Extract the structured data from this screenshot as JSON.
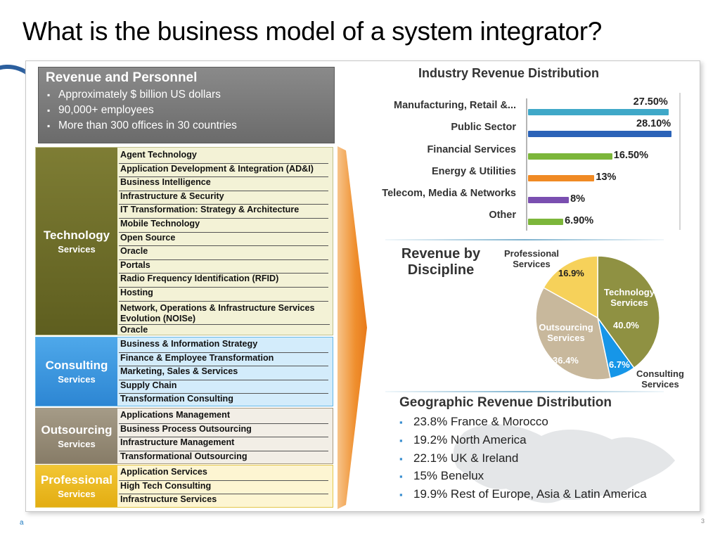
{
  "slide": {
    "title": "What is the business model of a system integrator?",
    "footer_left": "a",
    "footer_right": "3"
  },
  "revenue_personnel": {
    "title": "Revenue and Personnel",
    "items": [
      "Approximately $  billion US dollars",
      "90,000+ employees",
      "More than 300 offices in 30 countries"
    ]
  },
  "services": {
    "technology": {
      "title": "Technology",
      "subtitle": "Services",
      "items": [
        "Agent Technology",
        "Application Development & Integration (AD&I)",
        "Business Intelligence",
        "Infrastructure & Security",
        "IT Transformation: Strategy & Architecture",
        "Mobile Technology",
        "Open Source",
        "Oracle",
        "Portals",
        "Radio Frequency Identification (RFID)",
        "Hosting",
        "Network, Operations & Infrastructure Services Evolution (NOISe)",
        "Oracle"
      ]
    },
    "consulting": {
      "title": "Consulting",
      "subtitle": "Services",
      "items": [
        "Business & Information Strategy",
        "Finance & Employee Transformation",
        "Marketing, Sales & Services",
        "Supply Chain",
        "Transformation Consulting"
      ]
    },
    "outsourcing": {
      "title": "Outsourcing",
      "subtitle": "Services",
      "items": [
        "Applications Management",
        "Business Process Outsourcing",
        "Infrastructure Management",
        "Transformational Outsourcing"
      ]
    },
    "professional": {
      "title": "Professional",
      "subtitle": "Services",
      "items": [
        "Application Services",
        "High Tech Consulting",
        "Infrastructure Services"
      ]
    }
  },
  "chart_data": [
    {
      "type": "bar",
      "title": "Industry Revenue Distribution",
      "orientation": "horizontal",
      "categories": [
        "Manufacturing, Retail &...",
        "Public Sector",
        "Financial Services",
        "Energy & Utilities",
        "Telecom, Media & Networks",
        "Other"
      ],
      "values": [
        27.5,
        28.1,
        16.5,
        13,
        8,
        6.9
      ],
      "labels": [
        "27.50%",
        "28.10%",
        "16.50%",
        "13%",
        "8%",
        "6.90%"
      ],
      "colors": [
        "#3fa8c8",
        "#2b63b8",
        "#7cb63a",
        "#f08a24",
        "#7a4fb0",
        "#7cb63a"
      ]
    },
    {
      "type": "pie",
      "title": "Revenue by Discipline",
      "categories": [
        "Technology Services",
        "Consulting Services",
        "Outsourcing Services",
        "Professional Services"
      ],
      "values": [
        40.0,
        6.7,
        36.4,
        16.9
      ],
      "labels": [
        "40.0%",
        "6.7%",
        "36.4%",
        "16.9%"
      ],
      "colors": [
        "#8f9142",
        "#1696e8",
        "#c8b89c",
        "#f6d15a"
      ]
    }
  ],
  "pie_labels": {
    "technology": "Technology Services",
    "consulting": "Consulting Services",
    "outsourcing": "Outsourcing Services",
    "professional": "Professional Services"
  },
  "geo": {
    "title": "Geographic Revenue Distribution",
    "items": [
      "23.8% France & Morocco",
      "19.2% North America",
      "22.1% UK & Ireland",
      "15% Benelux",
      "19.9% Rest of Europe, Asia & Latin America"
    ]
  }
}
